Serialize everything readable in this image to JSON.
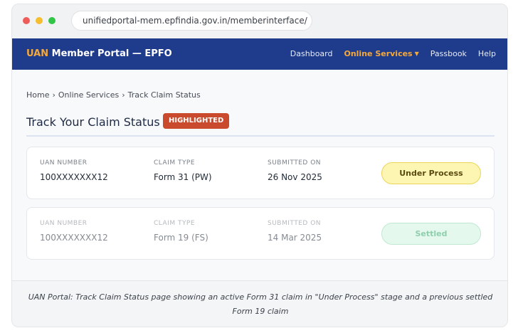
{
  "browser": {
    "url": "unifiedportal-mem.epfindia.gov.in/memberinterface/"
  },
  "navbar": {
    "brand_accent": "UAN",
    "brand_rest": " Member Portal — EPFO",
    "links": [
      {
        "label": "Dashboard"
      },
      {
        "label": "Online Services",
        "active": true
      },
      {
        "label": "Passbook"
      },
      {
        "label": "Help"
      }
    ]
  },
  "breadcrumb": [
    "Home",
    "Online Services",
    "Track Claim Status"
  ],
  "page": {
    "title": "Track Your Claim Status",
    "badge": "HIGHLIGHTED"
  },
  "claims": [
    {
      "uan_label": "UAN NUMBER",
      "uan": "100XXXXXXX12",
      "type_label": "CLAIM TYPE",
      "type": "Form 31 (PW)",
      "date_label": "SUBMITTED ON",
      "date": "26 Nov 2025",
      "status": "Under Process"
    },
    {
      "uan_label": "UAN NUMBER",
      "uan": "100XXXXXXX12",
      "type_label": "CLAIM TYPE",
      "type": "Form 19 (FS)",
      "date_label": "SUBMITTED ON",
      "date": "14 Mar 2025",
      "status": "Settled"
    }
  ],
  "caption": "UAN Portal: Track Claim Status page showing an active Form 31 claim in \"Under Process\" stage and a previous settled Form 19 claim",
  "colors": {
    "navbar": "#1e3b8c",
    "accent": "#f6a93b",
    "badge": "#c94a2c",
    "under_process": "#fdf5b2",
    "settled": "#e5f8ee"
  }
}
